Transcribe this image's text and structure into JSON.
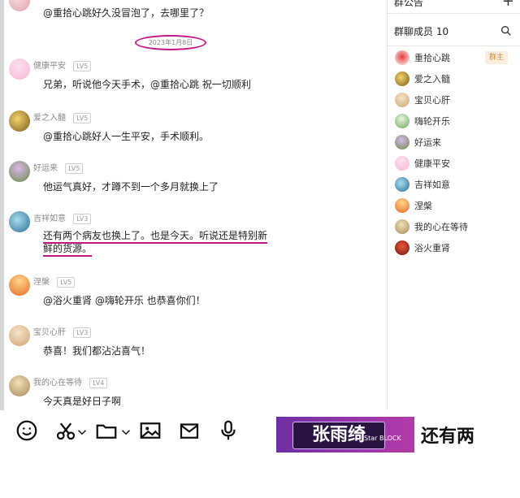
{
  "chat": {
    "top_message": "@重拾心跳好久没冒泡了，去哪里了？",
    "date": "2023年1月8日",
    "messages": [
      {
        "name": "健康平安",
        "level": "LV5",
        "text": "兄弟，听说他今天手术，@重拾心跳 祝一切顺利"
      },
      {
        "name": "爱之入髓",
        "level": "LV5",
        "text": "@重拾心跳好人一生平安，手术顺利。"
      },
      {
        "name": "好运来",
        "level": "LV5",
        "text": "他运气真好，才蹲不到一个多月就换上了"
      },
      {
        "name": "吉祥如意",
        "level": "LV3",
        "text_line1": "还有两个病友也换上了。也是今天。听说还是特别新",
        "text_line2": "鲜的货源。"
      },
      {
        "name": "涅槃",
        "level": "LV5",
        "text": "@浴火重肾 @嗨轮开乐 也恭喜你们！"
      },
      {
        "name": "宝贝心肝",
        "level": "LV3",
        "text": "恭喜！我们都沾沾喜气！"
      },
      {
        "name": "我的心在等待",
        "level": "LV4",
        "text": "今天真是好日子啊"
      }
    ]
  },
  "sidebar": {
    "announcement_title": "群公告",
    "plus": "+",
    "members_title": "群聊成员 10",
    "members": [
      {
        "name": "重拾心跳",
        "role": "群主"
      },
      {
        "name": "爱之入髓"
      },
      {
        "name": "宝贝心肝"
      },
      {
        "name": "嗨轮开乐"
      },
      {
        "name": "好运来"
      },
      {
        "name": "健康平安"
      },
      {
        "name": "吉祥如意"
      },
      {
        "name": "涅槃"
      },
      {
        "name": "我的心在等待"
      },
      {
        "name": "浴火重肾"
      }
    ]
  },
  "toolbar": {
    "icons": [
      "emoji-icon",
      "scissors-icon",
      "folder-icon",
      "image-icon",
      "envelope-icon",
      "microphone-icon"
    ]
  },
  "banner": {
    "name": "张雨绮",
    "tag": "Star BLOCK",
    "right_text": "还有两"
  },
  "colors": {
    "accent": "#c2178a",
    "role_bg": "#fbeee0",
    "role_text": "#d38a3a",
    "banner_gradient_start": "#6e2fa4",
    "banner_gradient_end": "#b43aa9"
  }
}
